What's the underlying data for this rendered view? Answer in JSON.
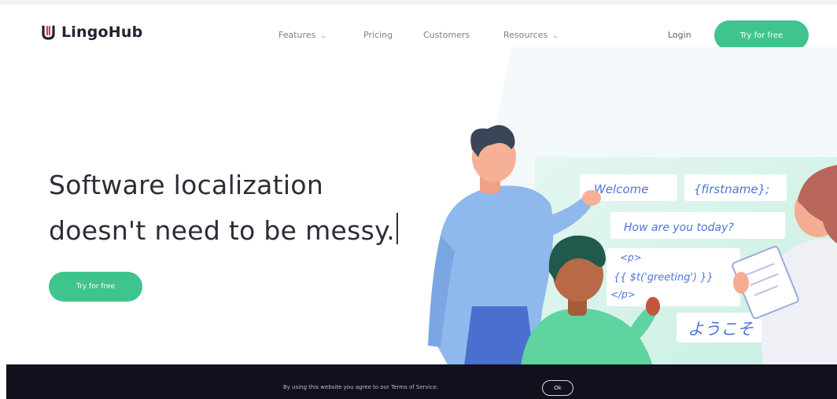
{
  "header": {
    "brand": "LingoHub",
    "nav": [
      {
        "label": "Features",
        "dropdown": true
      },
      {
        "label": "Pricing",
        "dropdown": false
      },
      {
        "label": "Customers",
        "dropdown": false
      },
      {
        "label": "Resources",
        "dropdown": true
      }
    ],
    "login_label": "Login",
    "cta_label": "Try for free"
  },
  "hero": {
    "headline_line1": "Software localization",
    "headline_line2": "doesn't need to be messy.",
    "cta_label": "Try for free"
  },
  "illustration": {
    "bubble_welcome": "Welcome",
    "bubble_firstname": "{firstname};",
    "bubble_question": "How are you today?",
    "code_line1": "<p>",
    "code_line2": "{{ $t('greeting') }}",
    "code_line3": "</p>",
    "bubble_japanese": "ようこそ"
  },
  "cookie_bar": {
    "message": "By using this website you agree to our Terms of Service.",
    "ok_label": "Ok"
  },
  "colors": {
    "accent": "#3fc48d",
    "cookie_bg": "#11111e",
    "bubble_text": "#4f74d9"
  }
}
